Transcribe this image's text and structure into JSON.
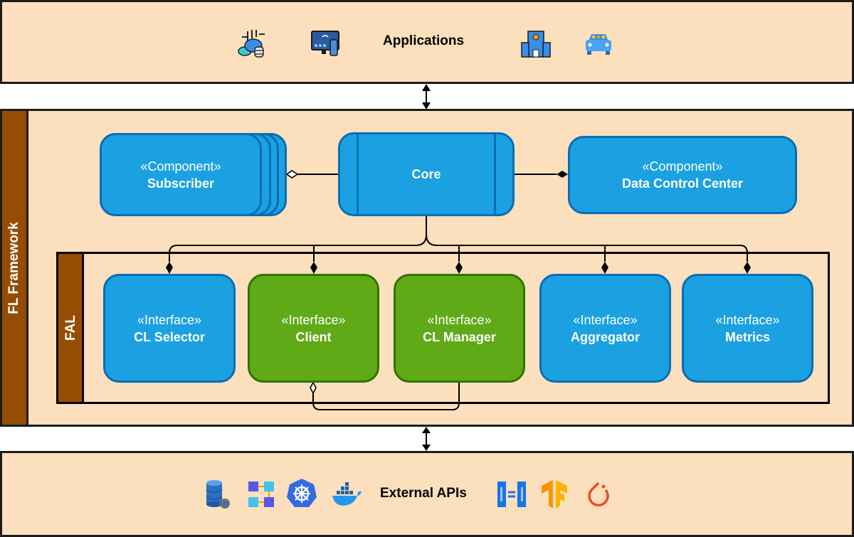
{
  "applications_layer": {
    "label": "Applications",
    "icons": [
      "cloud-data-icon",
      "smart-tv-icon",
      "hospital-icon",
      "car-icon"
    ]
  },
  "framework": {
    "label": "FL Framework",
    "core": {
      "name": "Core"
    },
    "subscriber": {
      "stereotype": "«Component»",
      "name": "Subscriber"
    },
    "data_control_center": {
      "stereotype": "«Component»",
      "name": "Data Control Center"
    },
    "fal": {
      "label": "FAL",
      "interfaces": [
        {
          "stereotype": "«Interface»",
          "name": "CL Selector",
          "color": "blue"
        },
        {
          "stereotype": "«Interface»",
          "name": "Client",
          "color": "green"
        },
        {
          "stereotype": "«Interface»",
          "name": "CL Manager",
          "color": "green"
        },
        {
          "stereotype": "«Interface»",
          "name": "Aggregator",
          "color": "blue"
        },
        {
          "stereotype": "«Interface»",
          "name": "Metrics",
          "color": "blue"
        }
      ]
    }
  },
  "external_layer": {
    "label": "External APIs",
    "icons": [
      "database-gear-icon",
      "network-nodes-icon",
      "kubernetes-icon",
      "docker-icon",
      "server-sync-icon",
      "tensorflow-icon",
      "pytorch-icon"
    ]
  },
  "colors": {
    "layer_bg": "#fcdfbd",
    "sidebar_brown": "#954d04",
    "blue_box": "#1ba1e2",
    "green_box": "#60a917"
  }
}
